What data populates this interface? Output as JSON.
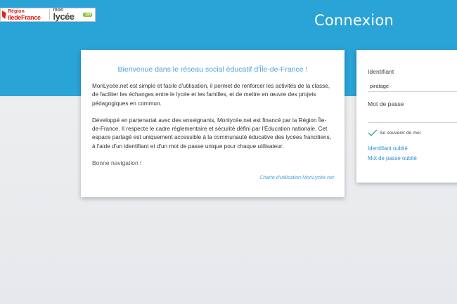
{
  "header": {
    "logo_region_line1": "Région",
    "logo_region_line2": "îledeFrance",
    "logo_lycee_mon": "mon",
    "logo_lycee_name": "lycée",
    "logo_lycee_net": ".net",
    "page_title": "Connexion"
  },
  "welcome": {
    "title": "Bienvenue dans le réseau social éducatif d'Île-de-France !",
    "paragraph1": "MonLycée.net est simple et facile d'utilisation, il permet de renforcer les activités de la classe, de faciliter les échanges entre le lycée et les familles, et de mettre en œuvre des projets pédagogiques en commun.",
    "paragraph2": "Développé en partenariat avec des enseignants, Monlycée.net est financé par la Région Île-de-France. Il respecte le cadre réglementaire et sécurité défini par l'Éducation nationale. Cet espace partagé est uniquement accessible à la communauté éducative des lycées franciliens, à l'aide d'un identifiant et d'un mot de passe unique pour chaque utilisateur.",
    "sign_off": "Bonne navigation !",
    "charter_link": "Charte d'utilisation MonLycée.net"
  },
  "login": {
    "identifier_label": "Identifiant",
    "identifier_value": "piratage",
    "password_label": "Mot de passe",
    "password_value": "",
    "remember_label": "Se souvenir de moi",
    "remember_checked": true,
    "forgot_identifier": "Identifiant oublié",
    "forgot_password": "Mot de passe oublié"
  },
  "colors": {
    "header_blue": "#2aa3d6",
    "link_blue": "#2a93cf",
    "title_blue": "#4fa3e0",
    "check_teal": "#3aa6a0",
    "region_red": "#e2231a",
    "net_green": "#8dc63f"
  },
  "icons": {
    "remember_check": "checkmark-icon",
    "region_logo": "region-mark-icon"
  }
}
